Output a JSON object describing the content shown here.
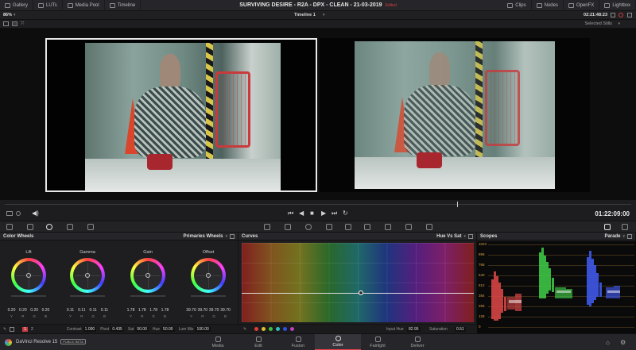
{
  "topbar": {
    "items": [
      "Gallery",
      "LUTs",
      "Media Pool",
      "Timeline"
    ],
    "project_title": "SURVIVING DESIRE - R2A - DPX - CLEAN - 21-03-2019",
    "edited_label": "Edited",
    "right_items": [
      "Clips",
      "Nodes",
      "OpenFX",
      "Lightbox"
    ]
  },
  "viewer_bar": {
    "zoom": "86%",
    "timeline_name": "Timeline 1",
    "source_timecode": "02:21:48:23"
  },
  "gallery_bar": {
    "selected_stills": "Selected Stills"
  },
  "transport": {
    "timecode": "01:22:09:00"
  },
  "color_wheels": {
    "panel_title": "Color Wheels",
    "mode": "Primaries Wheels",
    "wheels": [
      {
        "label": "Lift",
        "values": [
          "0.20",
          "0.20",
          "0.20",
          "0.20"
        ]
      },
      {
        "label": "Gamma",
        "values": [
          "0.11",
          "0.11",
          "0.11",
          "0.11"
        ]
      },
      {
        "label": "Gain",
        "values": [
          "1.78",
          "1.78",
          "1.78",
          "1.78"
        ]
      },
      {
        "label": "Offset",
        "values": [
          "39.70",
          "39.70",
          "39.70",
          "39.70"
        ]
      }
    ],
    "channels": [
      "Y",
      "R",
      "G",
      "B"
    ],
    "page_numbers": [
      "1",
      "2"
    ],
    "params": [
      {
        "label": "Contrast",
        "value": "1.000"
      },
      {
        "label": "Pivot",
        "value": "0.435"
      },
      {
        "label": "Sat",
        "value": "50.00"
      },
      {
        "label": "Hue",
        "value": "50.00"
      },
      {
        "label": "Lum Mix",
        "value": "100.00"
      }
    ]
  },
  "curves": {
    "panel_title": "Curves",
    "mode": "Hue Vs Sat",
    "input_hue_label": "Input Hue",
    "input_hue_value": "82.95",
    "saturation_label": "Saturation",
    "saturation_value": "0.51",
    "dot_colors": [
      "#e0403a",
      "#e0c030",
      "#40c040",
      "#30c0c0",
      "#3050e0",
      "#c040c0"
    ]
  },
  "scopes": {
    "panel_title": "Scopes",
    "mode": "Parade",
    "scale": [
      "1023",
      "896",
      "768",
      "640",
      "512",
      "384",
      "256",
      "128",
      "0"
    ]
  },
  "bottombar": {
    "app_name": "DaVinci Resolve 15",
    "beta_badge": "PUBLIC BETA",
    "pages": [
      "Media",
      "Edit",
      "Fusion",
      "Color",
      "Fairlight",
      "Deliver"
    ],
    "active_page": "Color"
  }
}
